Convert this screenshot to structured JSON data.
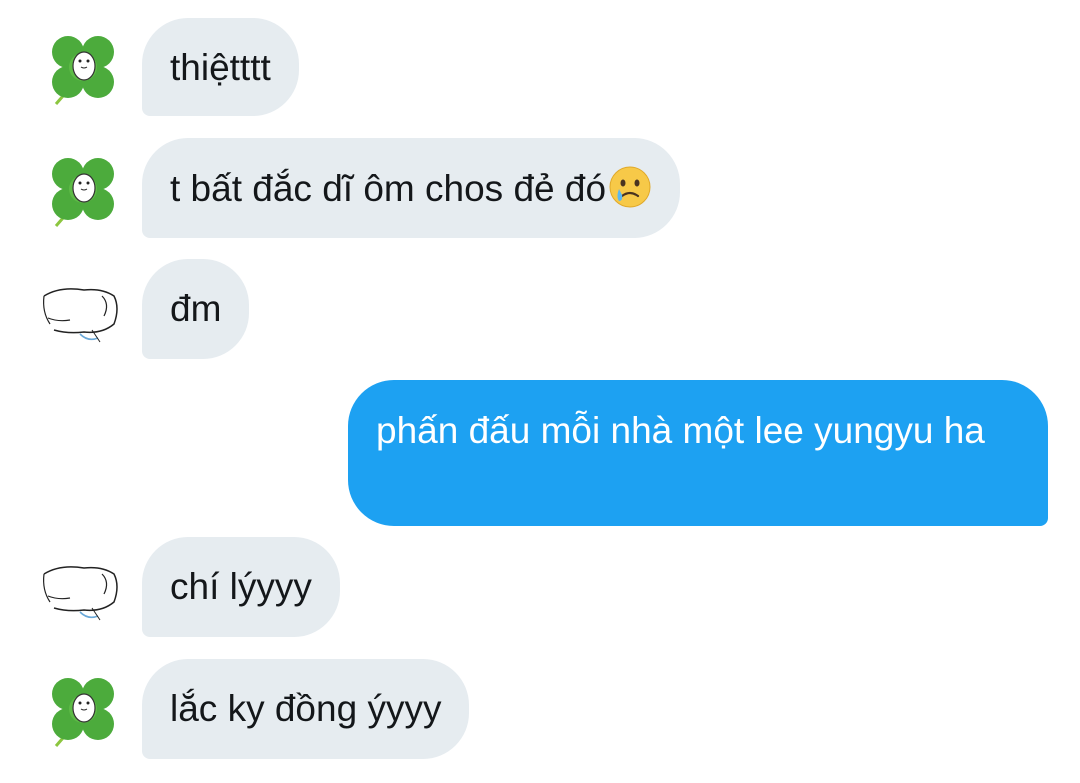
{
  "conversation": {
    "messages": [
      {
        "sender": "clover",
        "direction": "incoming",
        "text": "thiệtttt"
      },
      {
        "sender": "clover",
        "direction": "incoming",
        "text": "t bất đắc dĩ ôm chos đẻ đó",
        "emoji": "crying-face"
      },
      {
        "sender": "sketch",
        "direction": "incoming",
        "text": "đm"
      },
      {
        "sender": "me",
        "direction": "outgoing",
        "text": "phấn đấu mỗi nhà một lee yungyu ha"
      },
      {
        "sender": "sketch",
        "direction": "incoming",
        "text": "chí lýyyy"
      },
      {
        "sender": "clover",
        "direction": "incoming",
        "text": "lắc ky đồng ýyyy"
      }
    ]
  },
  "avatars": {
    "clover": "four-leaf-clover-avatar",
    "sketch": "sketched-hand-avatar"
  },
  "colors": {
    "incoming_bubble": "#e6ecf0",
    "outgoing_bubble": "#1da1f2",
    "incoming_text": "#14171a",
    "outgoing_text": "#ffffff"
  }
}
